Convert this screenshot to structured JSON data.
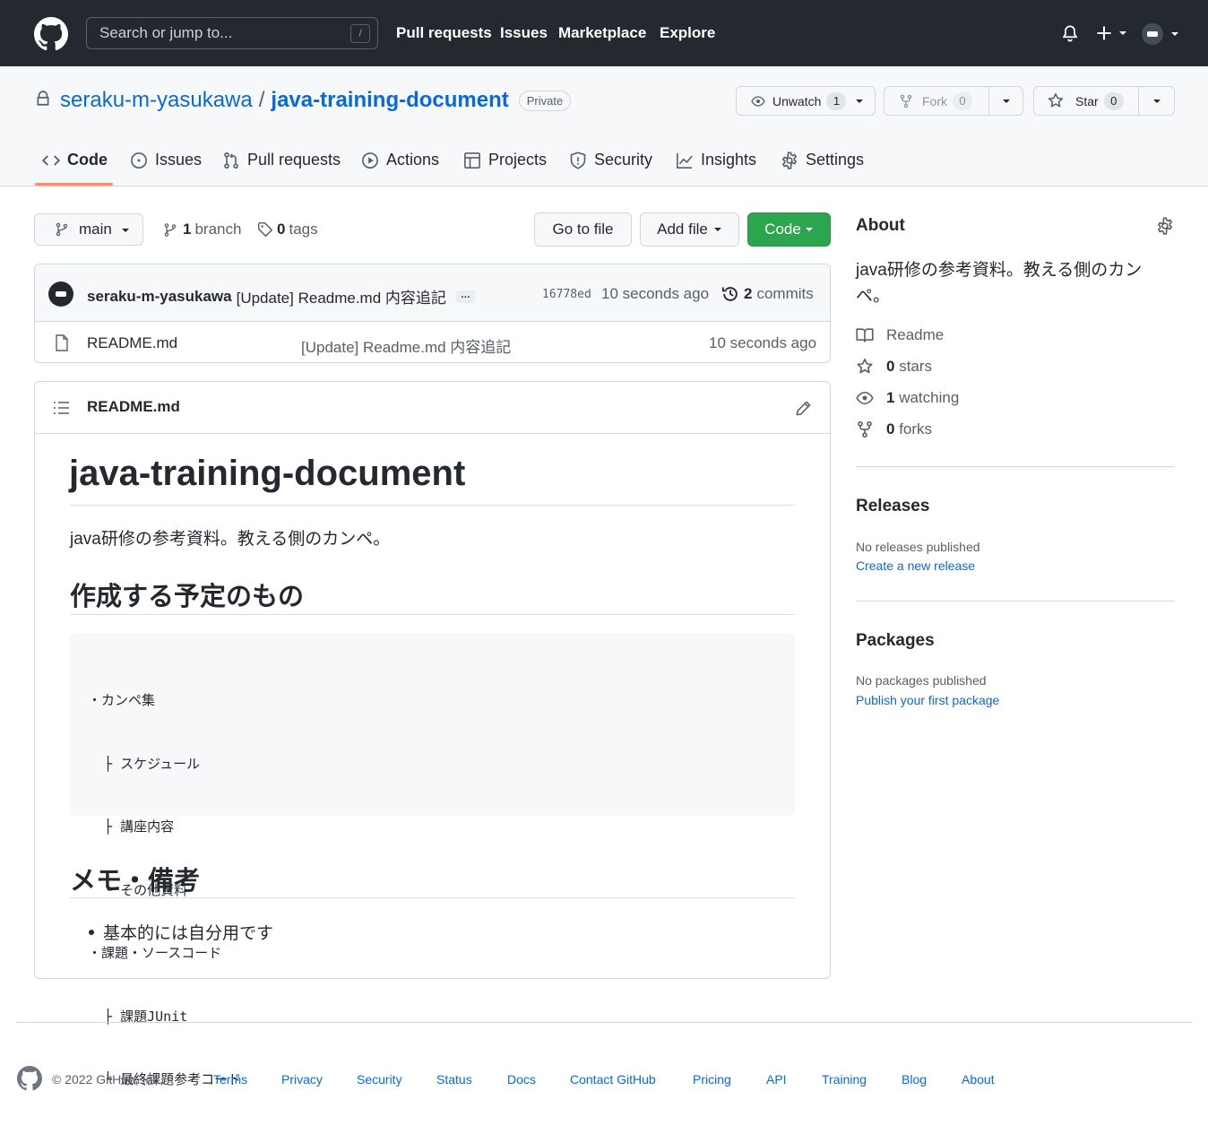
{
  "header": {
    "search_placeholder": "Search or jump to...",
    "search_shortcut": "/",
    "nav": [
      "Pull requests",
      "Issues",
      "Marketplace",
      "Explore"
    ]
  },
  "repo": {
    "owner": "seraku-m-yasukawa",
    "separator": "/",
    "name": "java-training-document",
    "visibility": "Private",
    "unwatch_label": "Unwatch",
    "watch_count": "1",
    "fork_label": "Fork",
    "fork_count": "0",
    "star_label": "Star",
    "star_count": "0"
  },
  "tabs": [
    "Code",
    "Issues",
    "Pull requests",
    "Actions",
    "Projects",
    "Security",
    "Insights",
    "Settings"
  ],
  "branchbar": {
    "branch": "main",
    "branch_count": "1",
    "branch_label": "branch",
    "tag_count": "0",
    "tag_label": "tags",
    "go_to_file": "Go to file",
    "add_file": "Add file",
    "code": "Code"
  },
  "commit": {
    "author": "seraku-m-yasukawa",
    "message": "[Update] Readme.md 内容追記",
    "ellipsis": "…",
    "sha": "16778ed",
    "time": "10 seconds ago",
    "commit_count": "2",
    "commit_label": "commits"
  },
  "files": [
    {
      "name": "README.md",
      "message": "[Update] Readme.md 内容追記",
      "time": "10 seconds ago"
    }
  ],
  "readme": {
    "filename": "README.md",
    "title": "java-training-document",
    "intro": "java研修の参考資料。教える側のカンペ。",
    "h2_plan": "作成する予定のもの",
    "code_lines": [
      "・カンペ集",
      "  ├ スケジュール",
      "  ├ 講座内容",
      "  └ その他資料",
      "・課題・ソースコード",
      "  ├ 課題JUnit",
      "  └ 最終課題参考コード"
    ],
    "h2_memo": "メモ・備考",
    "memo_item": "基本的には自分用です"
  },
  "about": {
    "heading": "About",
    "description": "java研修の参考資料。教える側のカン\nペ。",
    "readme": "Readme",
    "stars_count": "0",
    "stars_label": "stars",
    "watching_count": "1",
    "watching_label": "watching",
    "forks_count": "0",
    "forks_label": "forks"
  },
  "releases": {
    "heading": "Releases",
    "empty": "No releases published",
    "link": "Create a new release"
  },
  "packages": {
    "heading": "Packages",
    "empty": "No packages published",
    "link": "Publish your first package"
  },
  "footer": {
    "copyright": "© 2022 GitHub, Inc.",
    "links": [
      "Terms",
      "Privacy",
      "Security",
      "Status",
      "Docs",
      "Contact GitHub",
      "Pricing",
      "API",
      "Training",
      "Blog",
      "About"
    ]
  },
  "colors": {
    "header_bg": "#24292f",
    "link": "#0969da",
    "code_button": "#2da44e",
    "active_tab_underline": "#fd8c73"
  }
}
